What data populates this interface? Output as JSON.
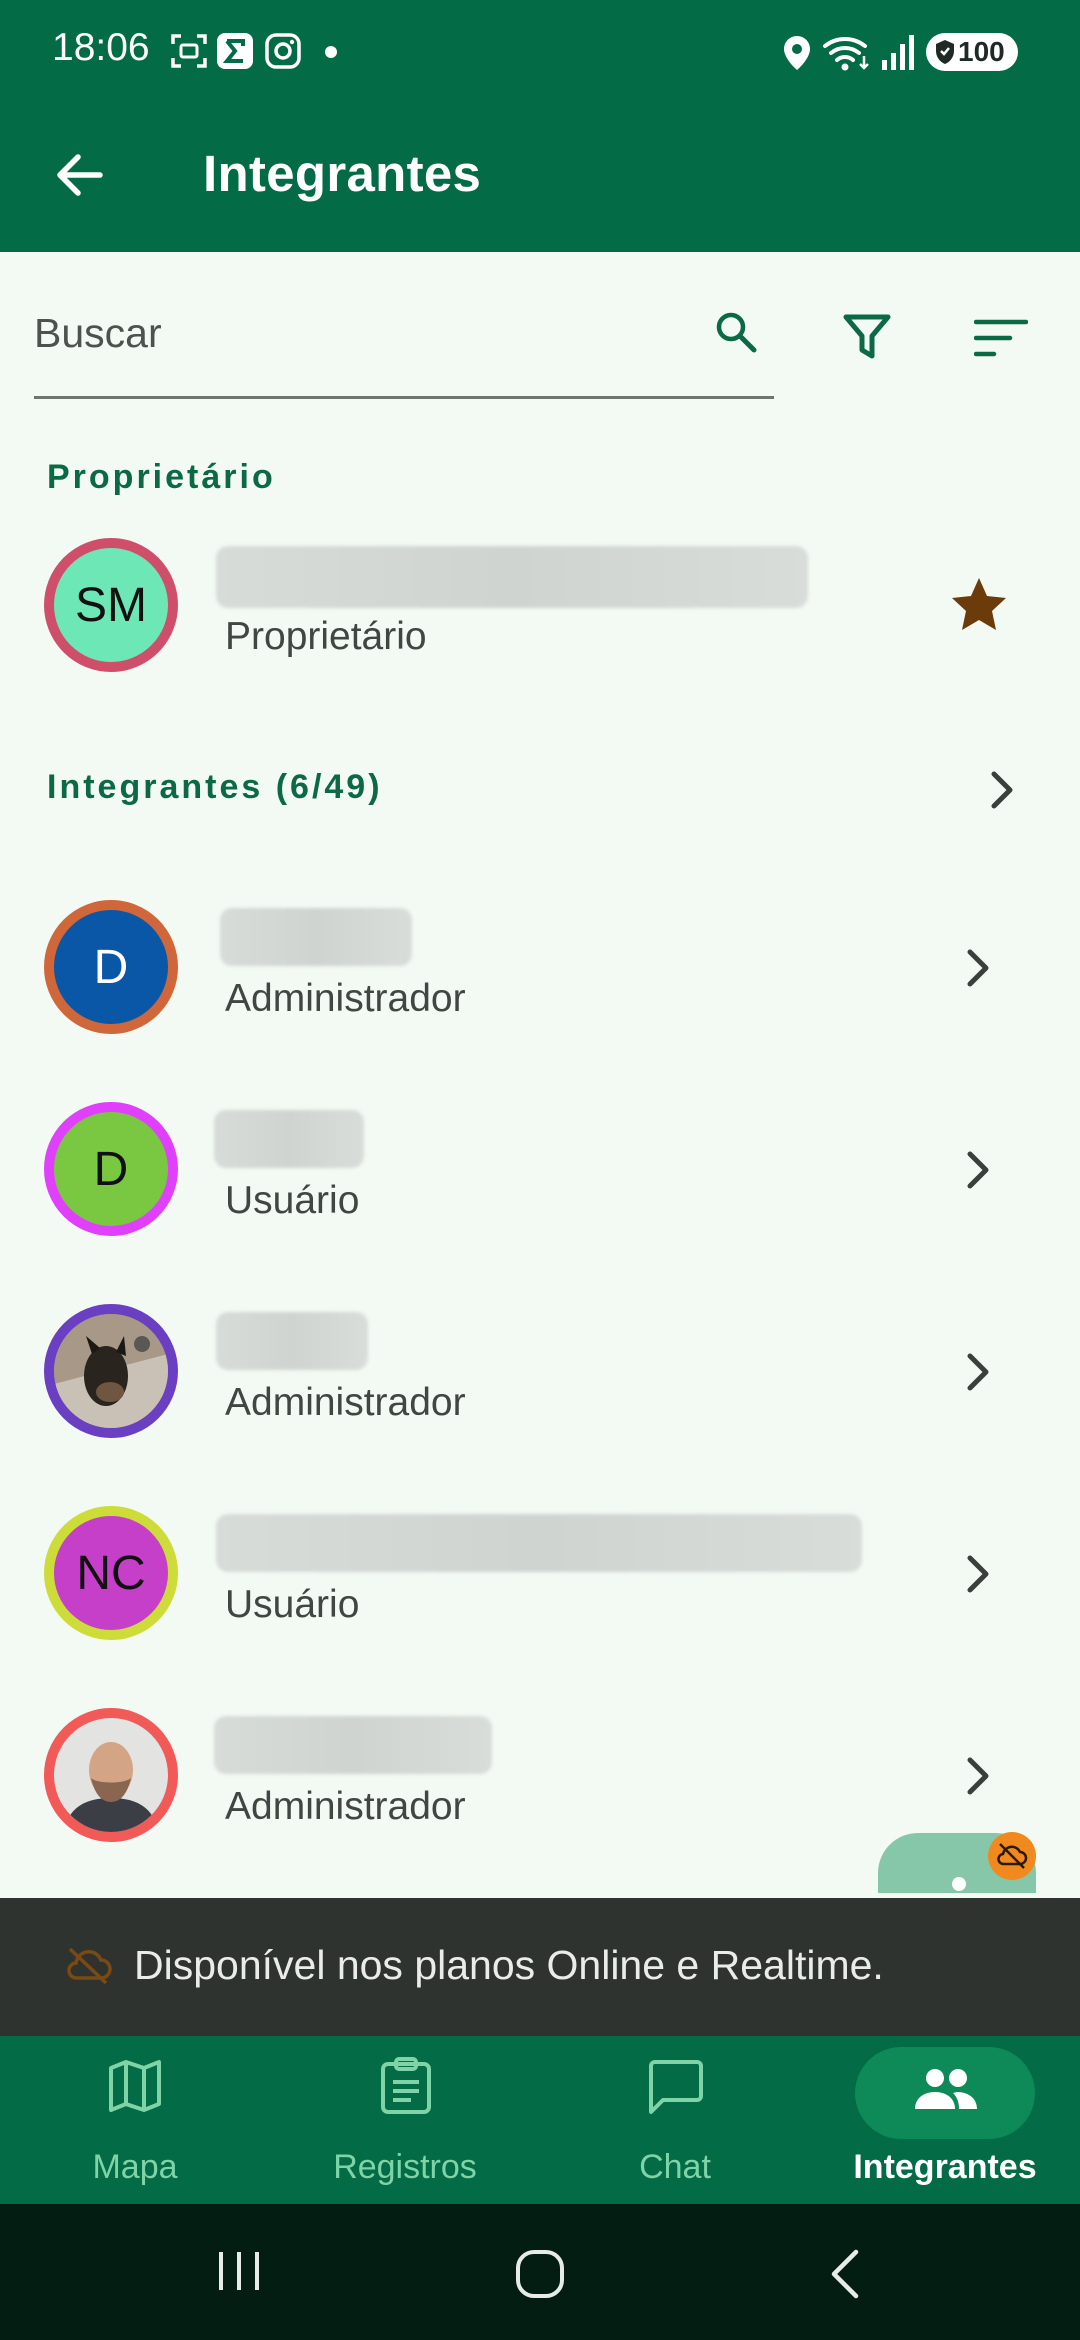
{
  "status_bar": {
    "time": "18:06",
    "battery": "100",
    "icons": [
      "screenshot-icon",
      "sigma-app-icon",
      "instagram-icon",
      "dot-icon",
      "location-icon",
      "wifi-icon",
      "signal-icon",
      "battery-icon"
    ]
  },
  "app_bar": {
    "title": "Integrantes",
    "back_icon": "arrow-left-icon"
  },
  "search": {
    "placeholder": "Buscar",
    "actions": [
      "search-icon",
      "filter-icon",
      "sort-icon"
    ]
  },
  "owner_section": {
    "header": "Proprietário",
    "member": {
      "initials": "SM",
      "role": "Proprietário",
      "avatar_color": "#6ee7b7",
      "ring_color": "#cf4f6a",
      "badge_icon": "star-icon"
    }
  },
  "members_section": {
    "header": "Integrantes (6/49)",
    "members": [
      {
        "initials": "D",
        "role": "Administrador",
        "avatar_color": "#0a57a8",
        "ring_color": "#d0673a",
        "text_color": "#ffffff"
      },
      {
        "initials": "D",
        "role": "Usuário",
        "avatar_color": "#7ac742",
        "ring_color": "#e040fb",
        "text_color": "#111111"
      },
      {
        "initials": "",
        "role": "Administrador",
        "avatar_color": "#9a8a7b",
        "ring_color": "#6a3fc2",
        "text_color": "#ffffff",
        "photo": "dog-photo"
      },
      {
        "initials": "NC",
        "role": "Usuário",
        "avatar_color": "#c63fc9",
        "ring_color": "#cddc39",
        "text_color": "#111111"
      },
      {
        "initials": "",
        "role": "Administrador",
        "avatar_color": "#6b6e72",
        "ring_color": "#f25a58",
        "text_color": "#ffffff",
        "photo": "man-photo"
      }
    ]
  },
  "snackbar": {
    "text": "Disponível nos planos Online e Realtime.",
    "icon": "cloud-off-icon"
  },
  "bottom_nav": {
    "items": [
      {
        "label": "Mapa",
        "icon": "map-icon"
      },
      {
        "label": "Registros",
        "icon": "clipboard-icon"
      },
      {
        "label": "Chat",
        "icon": "chat-icon"
      },
      {
        "label": "Integrantes",
        "icon": "people-icon",
        "active": true
      }
    ]
  },
  "colors": {
    "primary": "#036b45",
    "background": "#f3f9f3",
    "star": "#6b3b0a",
    "accent_light": "#7ed3a7"
  }
}
